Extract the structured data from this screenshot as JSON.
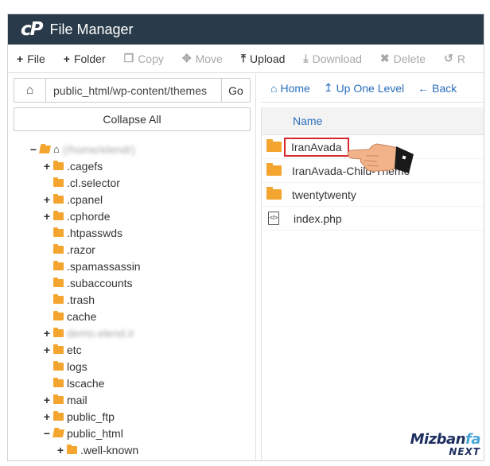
{
  "app": {
    "logo": "cP",
    "title": "File Manager"
  },
  "toolbar": {
    "items": [
      {
        "label": "File",
        "icon": "plus-icon",
        "glyph": "+",
        "enabled": true
      },
      {
        "label": "Folder",
        "icon": "plus-icon",
        "glyph": "+",
        "enabled": true
      },
      {
        "label": "Copy",
        "icon": "copy-icon",
        "glyph": "❐",
        "enabled": false
      },
      {
        "label": "Move",
        "icon": "move-icon",
        "glyph": "✥",
        "enabled": false
      },
      {
        "label": "Upload",
        "icon": "upload-icon",
        "glyph": "⤒",
        "enabled": true
      },
      {
        "label": "Download",
        "icon": "download-icon",
        "glyph": "⤓",
        "enabled": false
      },
      {
        "label": "Delete",
        "icon": "delete-icon",
        "glyph": "✖",
        "enabled": false
      },
      {
        "label": "R",
        "icon": "restore-icon",
        "glyph": "↺",
        "enabled": false
      }
    ]
  },
  "left": {
    "path_value": "public_html/wp-content/themes",
    "go_label": "Go",
    "collapse_label": "Collapse All"
  },
  "tree": [
    {
      "label": "(/home/elendr)",
      "level": 0,
      "toggle": "−",
      "icon": "home",
      "blurred": true
    },
    {
      "label": ".cagefs",
      "level": 1,
      "toggle": "+",
      "icon": "folder"
    },
    {
      "label": ".cl.selector",
      "level": 1,
      "toggle": "",
      "icon": "folder"
    },
    {
      "label": ".cpanel",
      "level": 1,
      "toggle": "+",
      "icon": "folder"
    },
    {
      "label": ".cphorde",
      "level": 1,
      "toggle": "+",
      "icon": "folder"
    },
    {
      "label": ".htpasswds",
      "level": 1,
      "toggle": "",
      "icon": "folder"
    },
    {
      "label": ".razor",
      "level": 1,
      "toggle": "",
      "icon": "folder"
    },
    {
      "label": ".spamassassin",
      "level": 1,
      "toggle": "",
      "icon": "folder"
    },
    {
      "label": ".subaccounts",
      "level": 1,
      "toggle": "",
      "icon": "folder"
    },
    {
      "label": ".trash",
      "level": 1,
      "toggle": "",
      "icon": "folder"
    },
    {
      "label": "cache",
      "level": 1,
      "toggle": "",
      "icon": "folder"
    },
    {
      "label": "demo.elend.ir",
      "level": 1,
      "toggle": "+",
      "icon": "folder",
      "blurred": true
    },
    {
      "label": "etc",
      "level": 1,
      "toggle": "+",
      "icon": "folder"
    },
    {
      "label": "logs",
      "level": 1,
      "toggle": "",
      "icon": "folder"
    },
    {
      "label": "lscache",
      "level": 1,
      "toggle": "",
      "icon": "folder"
    },
    {
      "label": "mail",
      "level": 1,
      "toggle": "+",
      "icon": "folder"
    },
    {
      "label": "public_ftp",
      "level": 1,
      "toggle": "+",
      "icon": "folder"
    },
    {
      "label": "public_html",
      "level": 1,
      "toggle": "−",
      "icon": "folder-open"
    },
    {
      "label": ".well-known",
      "level": 2,
      "toggle": "+",
      "icon": "folder"
    }
  ],
  "right": {
    "nav": [
      {
        "label": "Home",
        "glyph": "⌂",
        "icon": "home-icon"
      },
      {
        "label": "Up One Level",
        "glyph": "↥",
        "icon": "up-level-icon"
      },
      {
        "label": "Back",
        "glyph": "←",
        "icon": "back-arrow-icon"
      }
    ],
    "column_name": "Name",
    "files": [
      {
        "name": "IranAvada",
        "type": "folder",
        "highlighted": true
      },
      {
        "name": "IranAvada-Child-Theme",
        "type": "folder",
        "highlighted": false
      },
      {
        "name": "twentytwenty",
        "type": "folder",
        "highlighted": false
      },
      {
        "name": "index.php",
        "type": "php",
        "highlighted": false
      }
    ]
  },
  "watermark": {
    "line1_a": "Mizban",
    "line1_b": "fa",
    "line2": "NEXT"
  },
  "colors": {
    "titlebar": "#293a4a",
    "link": "#2a6ebb",
    "folder": "#f4a52f",
    "highlight": "#d6262b"
  }
}
